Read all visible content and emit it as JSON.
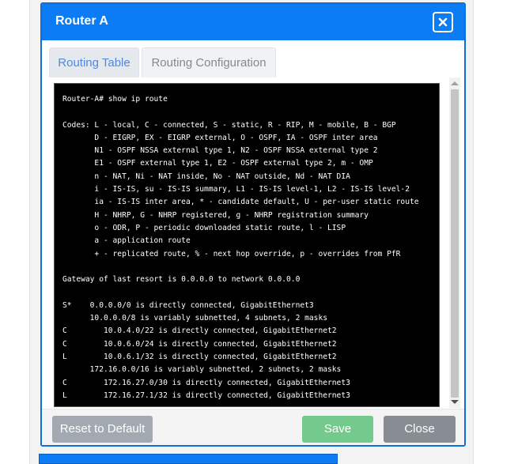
{
  "modal": {
    "title": "Router A"
  },
  "tabs": [
    {
      "label": "Routing Table",
      "active": true
    },
    {
      "label": "Routing Configuration",
      "active": false
    }
  ],
  "terminal": {
    "output": "Router-A# show ip route\n\nCodes: L - local, C - connected, S - static, R - RIP, M - mobile, B - BGP\n       D - EIGRP, EX - EIGRP external, O - OSPF, IA - OSPF inter area\n       N1 - OSPF NSSA external type 1, N2 - OSPF NSSA external type 2\n       E1 - OSPF external type 1, E2 - OSPF external type 2, m - OMP\n       n - NAT, Ni - NAT inside, No - NAT outside, Nd - NAT DIA\n       i - IS-IS, su - IS-IS summary, L1 - IS-IS level-1, L2 - IS-IS level-2\n       ia - IS-IS inter area, * - candidate default, U - per-user static route\n       H - NHRP, G - NHRP registered, g - NHRP registration summary\n       o - ODR, P - periodic downloaded static route, l - LISP\n       a - application route\n       + - replicated route, % - next hop override, p - overrides from PfR\n\nGateway of last resort is 0.0.0.0 to network 0.0.0.0\n\nS*    0.0.0.0/0 is directly connected, GigabitEthernet3\n      10.0.0.0/8 is variably subnetted, 4 subnets, 2 masks\nC        10.0.4.0/22 is directly connected, GigabitEthernet2\nC        10.0.6.0/24 is directly connected, GigabitEthernet2\nL        10.0.6.1/32 is directly connected, GigabitEthernet2\n      172.16.0.0/16 is variably subnetted, 2 subnets, 2 masks\nC        172.16.27.0/30 is directly connected, GigabitEthernet3\nL        172.16.27.1/32 is directly connected, GigabitEthernet3"
  },
  "footer": {
    "reset_label": "Reset to Default",
    "save_label": "Save",
    "close_label": "Close"
  },
  "colors": {
    "header": "#0b7cf4",
    "save": "#74c98c",
    "close": "#878d93",
    "reset": "#a2a9b0",
    "active_tab_text": "#4f88e0"
  },
  "icons": {
    "close": "close-icon"
  }
}
